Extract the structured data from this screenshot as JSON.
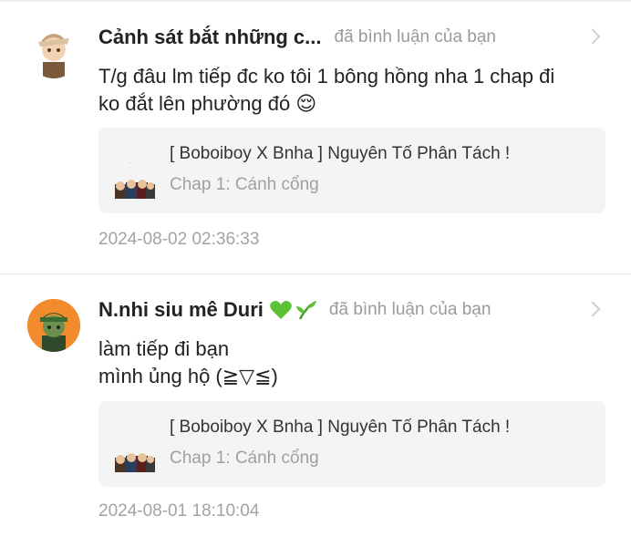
{
  "comments": [
    {
      "username": "Cảnh sát bắt những c...",
      "action": "đã bình luận của bạn",
      "text_lines": [
        "T/g đâu lm tiếp đc ko tôi 1 bông hồng nha 1 chap đi",
        "ko đắt lên phường đó 😌"
      ],
      "story_title": "[ Boboiboy X Bnha ] Nguyên Tố Phân Tách !",
      "story_chapter": "Chap 1: Cánh cổng",
      "timestamp": "2024-08-02 02:36:33"
    },
    {
      "username": "N.nhi siu mê Duri",
      "username_emoji": [
        "green-heart",
        "seedling"
      ],
      "action": "đã bình luận của bạn",
      "text_lines": [
        "làm tiếp đi bạn",
        "mình ủng hộ (≧▽≦)"
      ],
      "story_title": "[ Boboiboy X Bnha ] Nguyên Tố Phân Tách !",
      "story_chapter": "Chap 1: Cánh cổng",
      "timestamp": "2024-08-01 18:10:04"
    }
  ],
  "colors": {
    "card_bg": "#f4f4f4",
    "muted_text": "#9a9a9a",
    "avatar2_bg": "#f28a2e"
  }
}
